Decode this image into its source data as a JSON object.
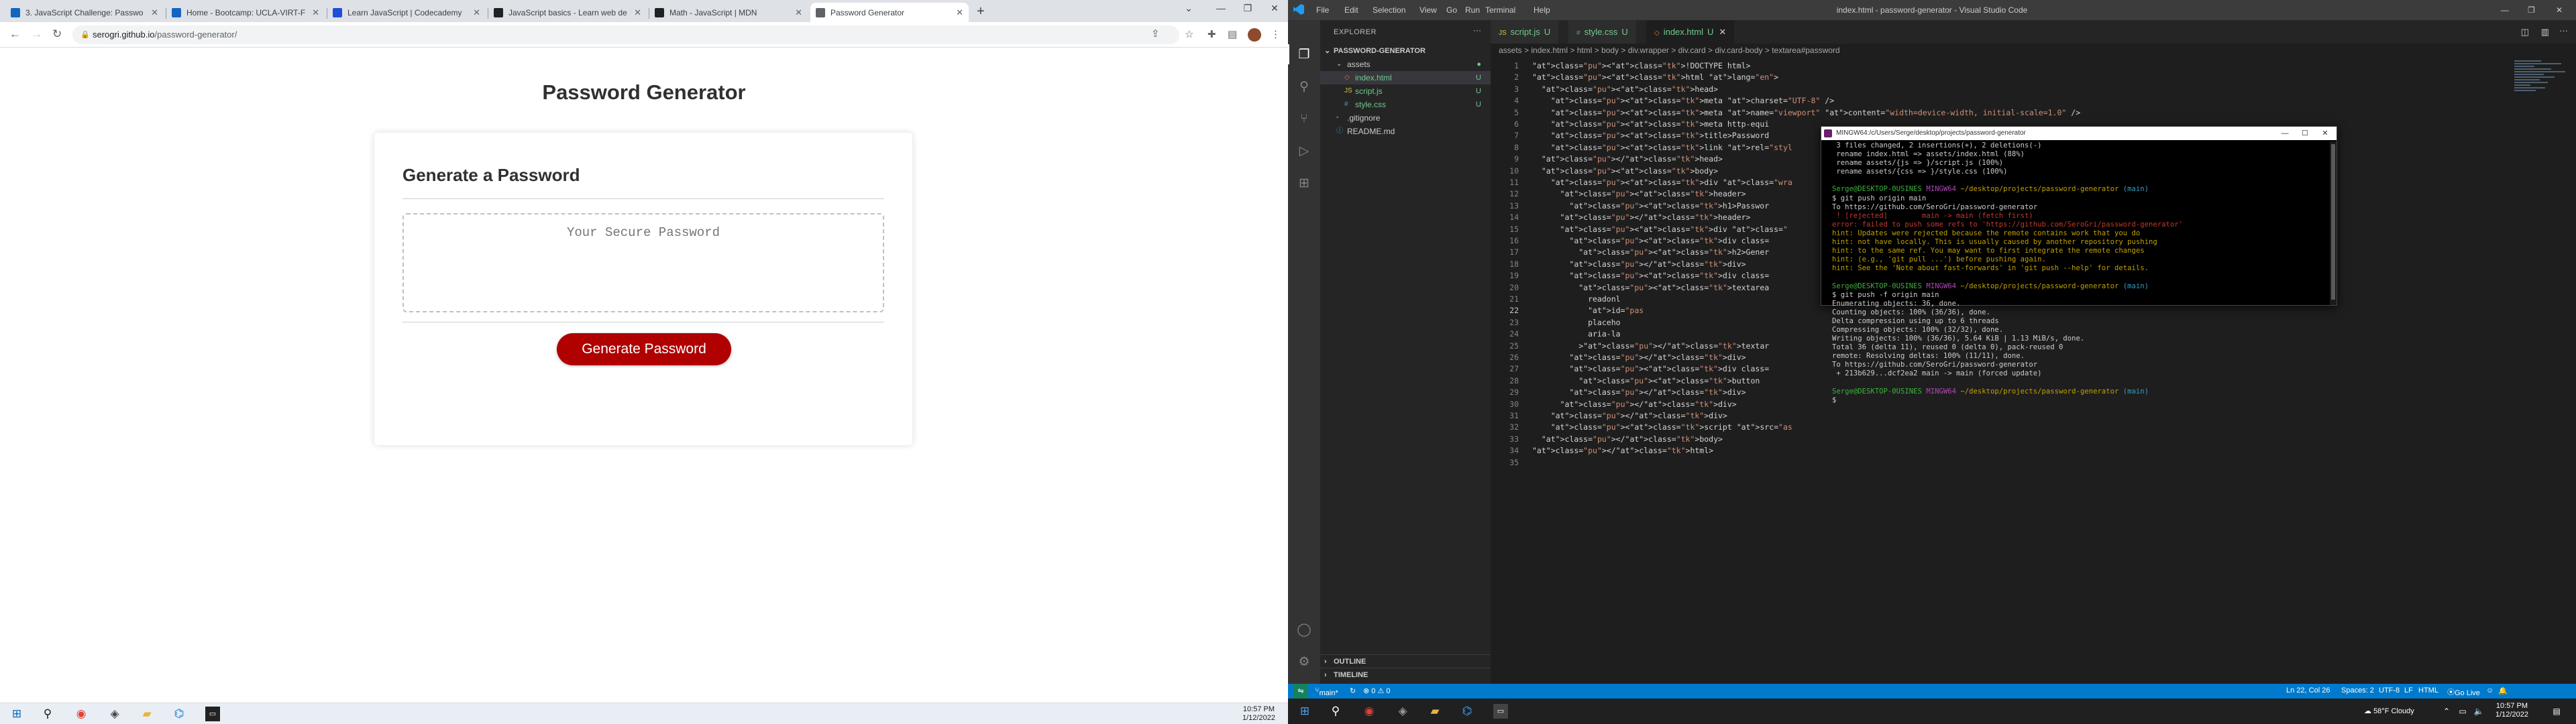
{
  "browser": {
    "tabs": [
      {
        "label": "3. JavaScript Challenge: Passwo",
        "color": "#1565c0"
      },
      {
        "label": "Home - Bootcamp: UCLA-VIRT-F",
        "color": "#1565c0"
      },
      {
        "label": "Learn JavaScript | Codecademy",
        "color": "#1f4fd8"
      },
      {
        "label": "JavaScript basics - Learn web de",
        "color": "#202124"
      },
      {
        "label": "Math - JavaScript | MDN",
        "color": "#202124"
      },
      {
        "label": "Password Generator",
        "color": "#5f6368"
      }
    ],
    "address_host": "serogri.github.io",
    "address_path": "/password-generator/"
  },
  "page": {
    "title": "Password Generator",
    "card_title": "Generate a Password",
    "password_placeholder": "Your Secure Password",
    "button_label": "Generate Password"
  },
  "taskbar_left": {
    "time": "10:57 PM",
    "date": "1/12/2022"
  },
  "vscode": {
    "window_title": "index.html - password-generator - Visual Studio Code",
    "menu": [
      "File",
      "Edit",
      "Selection",
      "View",
      "Go",
      "Run",
      "Terminal",
      "Help"
    ],
    "explorer_title": "EXPLORER",
    "project": "PASSWORD-GENERATOR",
    "files": [
      {
        "name": "assets",
        "status": "",
        "kind": "folder"
      },
      {
        "name": "index.html",
        "status": "U",
        "kind": "html"
      },
      {
        "name": "script.js",
        "status": "U",
        "kind": "js"
      },
      {
        "name": "style.css",
        "status": "U",
        "kind": "css"
      },
      {
        "name": ".gitignore",
        "status": "",
        "kind": "file"
      },
      {
        "name": "README.md",
        "status": "",
        "kind": "md"
      }
    ],
    "outline": "OUTLINE",
    "timeline": "TIMELINE",
    "editor_tabs": [
      {
        "label": "script.js",
        "status": "U"
      },
      {
        "label": "style.css",
        "status": "U"
      },
      {
        "label": "index.html",
        "status": "U"
      }
    ],
    "breadcrumb": "assets > index.html > html > body > div.wrapper > div.card > div.card-body > textarea#password",
    "code_lines": [
      "<!DOCTYPE html>",
      "<html lang=\"en\">",
      "  <head>",
      "    <meta charset=\"UTF-8\" />",
      "    <meta name=\"viewport\" content=\"width=device-width, initial-scale=1.0\" />",
      "    <meta http-equi",
      "    <title>Password",
      "    <link rel=\"styl",
      "  </head>",
      "  <body>",
      "    <div class=\"wra",
      "      <header>",
      "        <h1>Passwor",
      "      </header>",
      "      <div class=\"",
      "        <div class=",
      "          <h2>Gener",
      "        </div>",
      "        <div class=",
      "          <textarea",
      "            readonl",
      "            id=\"pas",
      "            placeho",
      "            aria-la",
      "          ></textar",
      "        </div>",
      "        <div class=",
      "          <button",
      "        </div>",
      "      </div>",
      "    </div>",
      "    <script src=\"as",
      "  </body>",
      "</html>",
      ""
    ],
    "terminal": {
      "title": "MINGW64:/c/Users/Serge/desktop/projects/password-generator",
      "lines": [
        {
          "t": " 3 files changed, 2 insertions(+), 2 deletions(-)",
          "c": ""
        },
        {
          "t": " rename index.html => assets/index.html (88%)",
          "c": ""
        },
        {
          "t": " rename assets/{js => }/script.js (100%)",
          "c": ""
        },
        {
          "t": " rename assets/{css => }/style.css (100%)",
          "c": ""
        },
        {
          "t": "",
          "c": ""
        },
        {
          "t": "Serge@DESKTOP-0USINES MINGW64 ~/desktop/projects/password-generator (main)",
          "c": "prompt"
        },
        {
          "t": "$ git push origin main",
          "c": ""
        },
        {
          "t": "To https://github.com/SeroGri/password-generator",
          "c": ""
        },
        {
          "t": " ! [rejected]        main -> main (fetch first)",
          "c": "red"
        },
        {
          "t": "error: failed to push some refs to 'https://github.com/SeroGri/password-generator'",
          "c": "red"
        },
        {
          "t": "hint: Updates were rejected because the remote contains work that you do",
          "c": "yellow"
        },
        {
          "t": "hint: not have locally. This is usually caused by another repository pushing",
          "c": "yellow"
        },
        {
          "t": "hint: to the same ref. You may want to first integrate the remote changes",
          "c": "yellow"
        },
        {
          "t": "hint: (e.g., 'git pull ...') before pushing again.",
          "c": "yellow"
        },
        {
          "t": "hint: See the 'Note about fast-forwards' in 'git push --help' for details.",
          "c": "yellow"
        },
        {
          "t": "",
          "c": ""
        },
        {
          "t": "Serge@DESKTOP-0USINES MINGW64 ~/desktop/projects/password-generator (main)",
          "c": "prompt"
        },
        {
          "t": "$ git push -f origin main",
          "c": ""
        },
        {
          "t": "Enumerating objects: 36, done.",
          "c": ""
        },
        {
          "t": "Counting objects: 100% (36/36), done.",
          "c": ""
        },
        {
          "t": "Delta compression using up to 6 threads",
          "c": ""
        },
        {
          "t": "Compressing objects: 100% (32/32), done.",
          "c": ""
        },
        {
          "t": "Writing objects: 100% (36/36), 5.64 KiB | 1.13 MiB/s, done.",
          "c": ""
        },
        {
          "t": "Total 36 (delta 11), reused 0 (delta 0), pack-reused 0",
          "c": ""
        },
        {
          "t": "remote: Resolving deltas: 100% (11/11), done.",
          "c": ""
        },
        {
          "t": "To https://github.com/SeroGri/password-generator",
          "c": ""
        },
        {
          "t": " + 213b629...dcf2ea2 main -> main (forced update)",
          "c": ""
        },
        {
          "t": "",
          "c": ""
        },
        {
          "t": "Serge@DESKTOP-0USINES MINGW64 ~/desktop/projects/password-generator (main)",
          "c": "prompt"
        },
        {
          "t": "$",
          "c": ""
        }
      ]
    },
    "status": {
      "branch": "main*",
      "problems": "⊗ 0 ⚠ 0",
      "position": "Ln 22, Col 26",
      "spaces": "Spaces: 2",
      "encoding": "UTF-8",
      "eol": "LF",
      "language": "HTML",
      "golive": "Go Live"
    }
  },
  "taskbar_right": {
    "weather": "58°F Cloudy",
    "time": "10:57 PM",
    "date": "1/12/2022"
  }
}
